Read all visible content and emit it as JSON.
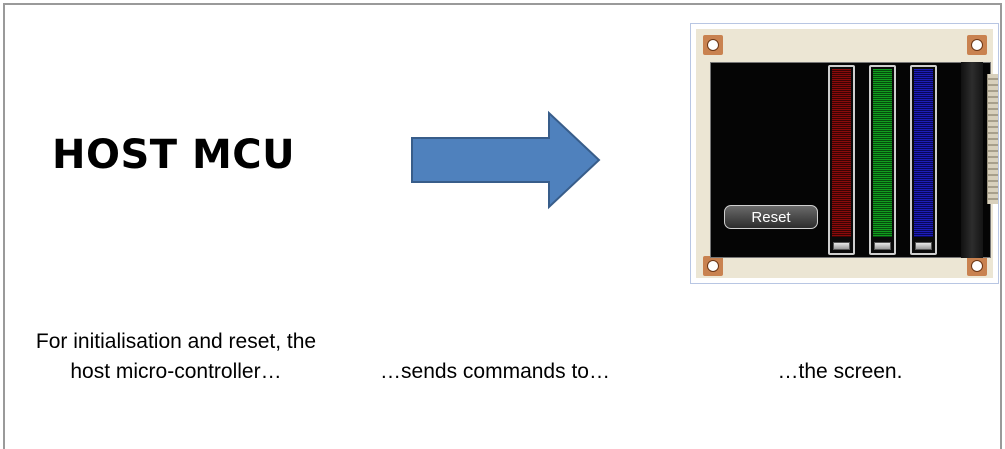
{
  "host_label": "HOST MCU",
  "arrow": {
    "icon": "right-arrow-icon",
    "fill": "#4f81bd",
    "stroke": "#385d8a"
  },
  "screen": {
    "button_label": "Reset",
    "sliders": [
      {
        "color": "red"
      },
      {
        "color": "green"
      },
      {
        "color": "blue"
      }
    ]
  },
  "captions": {
    "host": "For initialisation and reset, the host micro-controller…",
    "arrow": "…sends commands to…",
    "screen": "…the screen."
  }
}
